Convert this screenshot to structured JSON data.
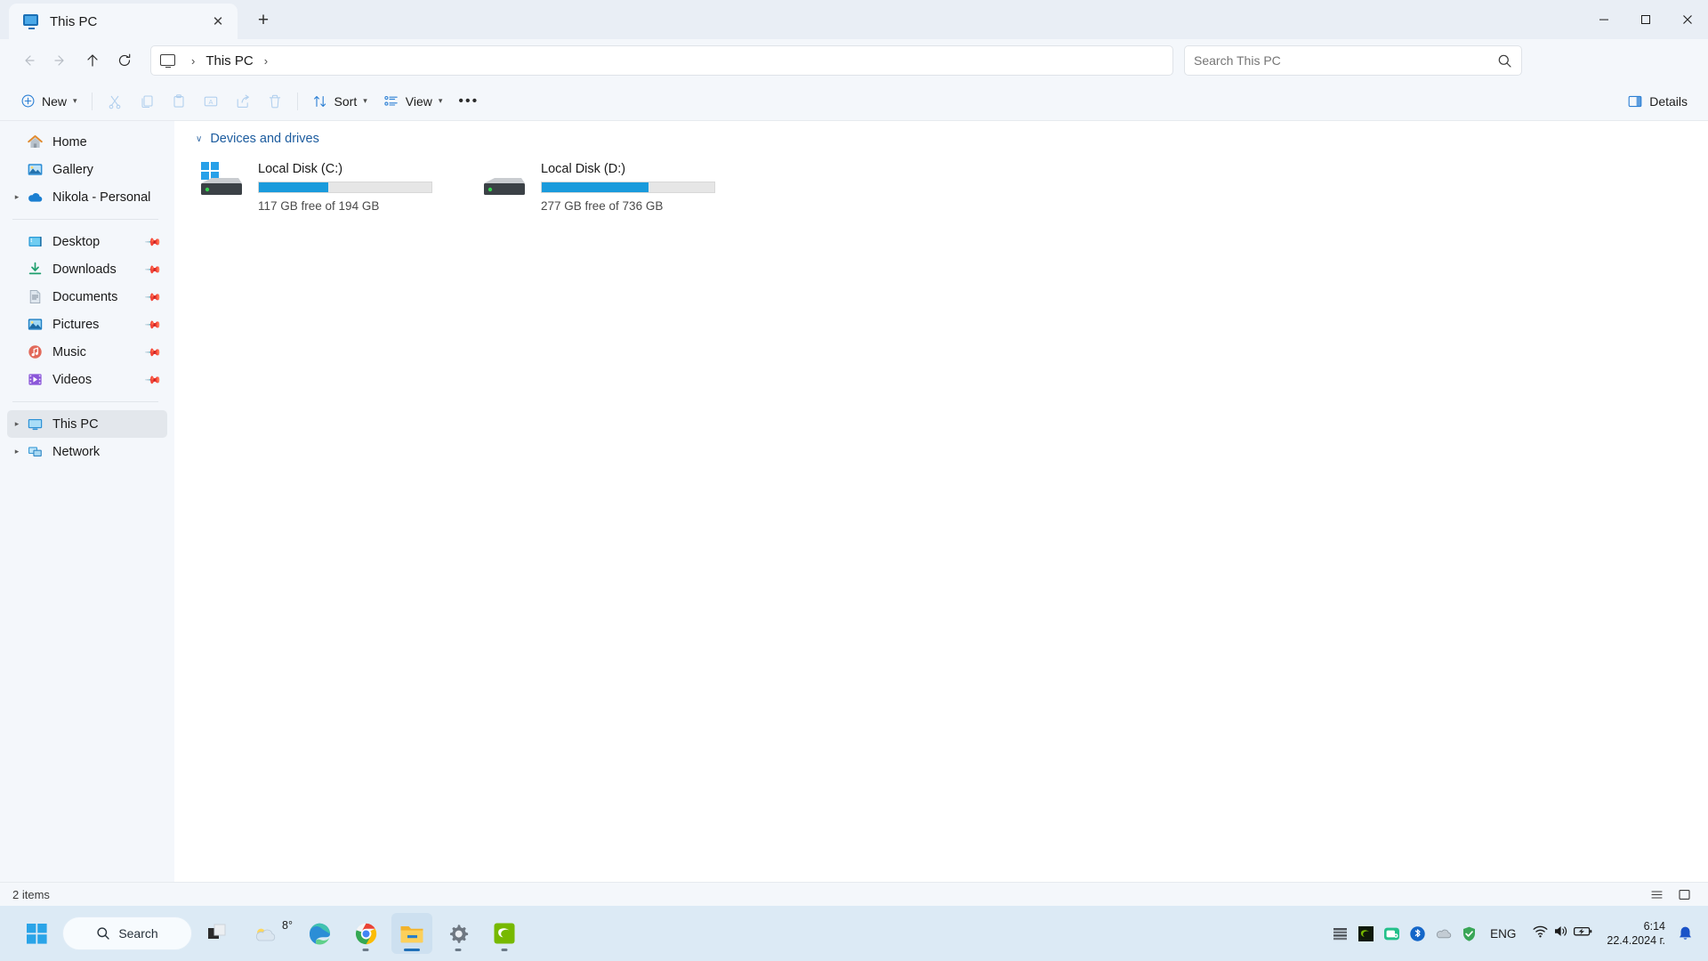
{
  "window": {
    "tab": {
      "title": "This PC",
      "icon": "this-pc-monitor-icon",
      "close_label": "✕"
    },
    "new_tab_label": "+",
    "controls": {
      "minimize": "–",
      "maximize": "☐",
      "close": "✕"
    }
  },
  "nav": {
    "back_label": "←",
    "forward_label": "→",
    "up_label": "↑",
    "refresh_label": "↻",
    "breadcrumb": {
      "root_icon": "this-pc-monitor-icon",
      "separator": "›",
      "text": "This PC",
      "trailing_separator": "›"
    }
  },
  "search": {
    "placeholder": "Search This PC",
    "value": ""
  },
  "toolbar": {
    "new_label": "New",
    "cut_label": "Cut",
    "copy_label": "Copy",
    "paste_label": "Paste",
    "rename_label": "Rename",
    "share_label": "Share",
    "delete_label": "Delete",
    "sort_label": "Sort",
    "view_label": "View",
    "more_label": "•••",
    "details_label": "Details"
  },
  "sidebar": {
    "items": [
      {
        "label": "Home",
        "icon": "home-icon",
        "expandable": false,
        "pinned": false,
        "selected": false
      },
      {
        "label": "Gallery",
        "icon": "gallery-icon",
        "expandable": false,
        "pinned": false,
        "selected": false
      },
      {
        "label": "Nikola - Personal",
        "icon": "onedrive-cloud-icon",
        "expandable": true,
        "pinned": false,
        "selected": false
      }
    ],
    "quick_access": [
      {
        "label": "Desktop",
        "icon": "desktop-folder-icon",
        "pinned": true
      },
      {
        "label": "Downloads",
        "icon": "downloads-arrow-icon",
        "pinned": true
      },
      {
        "label": "Documents",
        "icon": "documents-icon",
        "pinned": true
      },
      {
        "label": "Pictures",
        "icon": "pictures-icon",
        "pinned": true
      },
      {
        "label": "Music",
        "icon": "music-note-icon",
        "pinned": true
      },
      {
        "label": "Videos",
        "icon": "videos-film-icon",
        "pinned": true
      }
    ],
    "locations": [
      {
        "label": "This PC",
        "icon": "this-pc-monitor-icon",
        "expandable": true,
        "selected": true
      },
      {
        "label": "Network",
        "icon": "network-icon",
        "expandable": true,
        "selected": false
      }
    ],
    "pin_glyph": "📌"
  },
  "main": {
    "group_title": "Devices and drives",
    "group_chevron": "∨",
    "drives": [
      {
        "name": "Local Disk (C:)",
        "free_text": "117 GB free of 194 GB",
        "free_gb": 117,
        "total_gb": 194,
        "used_percent": 40,
        "bar_color": "#1a9bdc",
        "icon": "windows-drive-icon"
      },
      {
        "name": "Local Disk (D:)",
        "free_text": "277 GB free of 736 GB",
        "free_gb": 277,
        "total_gb": 736,
        "used_percent": 62,
        "bar_color": "#1a9bdc",
        "icon": "hard-drive-icon"
      }
    ]
  },
  "status": {
    "item_count": "2 items",
    "details_view_label": "≡",
    "large_icons_view_label": "▢"
  },
  "taskbar": {
    "start_label": "Start",
    "search_label": "Search",
    "weather": {
      "temperature": "8°",
      "icon": "cloud-icon"
    },
    "apps": [
      {
        "name": "task-view",
        "running": false
      },
      {
        "name": "weather-widget",
        "running": false
      },
      {
        "name": "microsoft-edge",
        "running": false
      },
      {
        "name": "google-chrome",
        "running": true
      },
      {
        "name": "file-explorer",
        "running": true,
        "active": true
      },
      {
        "name": "settings",
        "running": true
      },
      {
        "name": "nvidia-app",
        "running": true
      }
    ],
    "tray": [
      {
        "name": "hidden-icons-chevron"
      },
      {
        "name": "nvidia-tray-icon"
      },
      {
        "name": "screen-capture-icon"
      },
      {
        "name": "bluetooth-icon"
      },
      {
        "name": "onedrive-tray-icon"
      },
      {
        "name": "windows-security-icon"
      }
    ],
    "language": "ENG",
    "wifi_icon": "wifi-icon",
    "volume_icon": "volume-icon",
    "battery_icon": "battery-charging-icon",
    "clock": {
      "time": "6:14",
      "date": "22.4.2024 г."
    },
    "notification_icon": "bell-icon"
  },
  "colors": {
    "accent": "#1a9bdc",
    "taskbar_bg": "#dceaf5",
    "chrome_bg": "#f4f7fb",
    "link_blue": "#1b5b9e"
  }
}
